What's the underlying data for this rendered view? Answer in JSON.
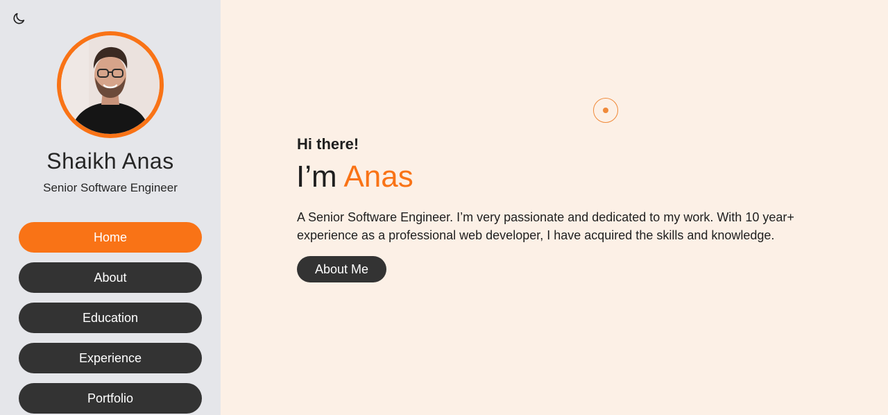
{
  "theme_toggle": {
    "icon": "moon-icon"
  },
  "profile": {
    "name": "Shaikh Anas",
    "role": "Senior Software Engineer",
    "accent_color": "#f97316"
  },
  "nav": {
    "items": [
      {
        "label": "Home",
        "active": true
      },
      {
        "label": "About",
        "active": false
      },
      {
        "label": "Education",
        "active": false
      },
      {
        "label": "Experience",
        "active": false
      },
      {
        "label": "Portfolio",
        "active": false
      }
    ]
  },
  "hero": {
    "greeting": "Hi there!",
    "headline_prefix": "I’m",
    "headline_name": "Anas",
    "intro": "A Senior Software Engineer. I’m very passionate and dedicated to my work. With 10 year+ experience as a professional web developer, I have acquired the skills and knowledge.",
    "button_label": "About Me"
  },
  "colors": {
    "sidebar_bg": "#e5e6ea",
    "main_bg": "#fcf0e6",
    "button_dark": "#333333",
    "accent": "#f97316"
  }
}
